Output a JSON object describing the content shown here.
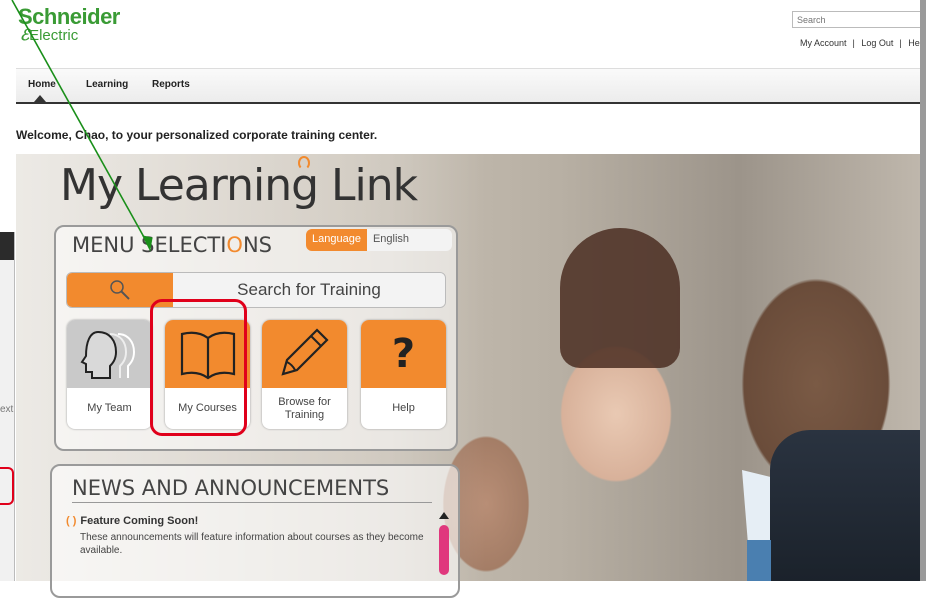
{
  "header": {
    "logo_line1": "Schneider",
    "logo_line2": "Electric",
    "search_placeholder": "Search",
    "account_links": [
      "My Account",
      "Log Out",
      "He"
    ]
  },
  "nav": {
    "items": [
      "Home",
      "Learning",
      "Reports"
    ]
  },
  "welcome": "Welcome, Chao, to your personalized corporate training center.",
  "hero": {
    "title": "My Learning Link"
  },
  "menu": {
    "title_pre": "MENU SELECTI",
    "title_o": "O",
    "title_post": "NS",
    "language_label": "Language",
    "language_value": "English",
    "search_label": "Search for Training",
    "tiles": [
      {
        "label": "My Team",
        "icon": "team-icon"
      },
      {
        "label": "My Courses",
        "icon": "book-icon"
      },
      {
        "label": "Browse for Training",
        "icon": "pencil-icon"
      },
      {
        "label": "Help",
        "icon": "question-icon"
      }
    ]
  },
  "news": {
    "title": "NEWS AND ANNOUNCEMENTS",
    "item_title": "Feature Coming Soon!",
    "item_body": "These announcements will feature information about courses as they become available."
  },
  "overlay": {
    "text": "ext"
  },
  "colors": {
    "brand_green": "#3a9b35",
    "accent_orange": "#f28a2e",
    "highlight_red": "#e0001b"
  }
}
